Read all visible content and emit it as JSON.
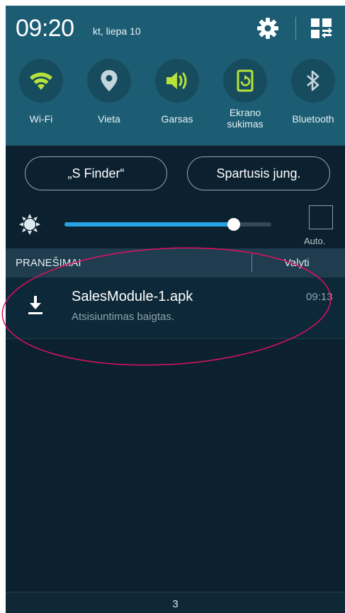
{
  "status": {
    "time": "09:20",
    "date": "kt, liepa 10"
  },
  "header_icons": {
    "settings": "gear-icon",
    "edit_grid": "grid-edit-icon"
  },
  "quick_toggles": [
    {
      "label": "Wi-Fi",
      "icon": "wifi-icon",
      "active": true
    },
    {
      "label": "Vieta",
      "icon": "location-pin-icon",
      "active": false
    },
    {
      "label": "Garsas",
      "icon": "speaker-icon",
      "active": true
    },
    {
      "label_line1": "Ekrano",
      "label_line2": "sukimas",
      "icon": "screen-rotation-icon",
      "active": true
    },
    {
      "label": "Bluetooth",
      "icon": "bluetooth-icon",
      "active": false
    }
  ],
  "buttons": {
    "s_finder": "„S Finder“",
    "quick_connect": "Spartusis jung."
  },
  "brightness": {
    "level": 0.82,
    "auto_label": "Auto.",
    "auto_checked": false
  },
  "notifications": {
    "title": "PRANEŠIMAI",
    "clear_label": "Valyti",
    "items": [
      {
        "icon": "download-icon",
        "title": "SalesModule-1.apk",
        "subtitle": "Atsisiuntimas baigtas.",
        "time": "09:13"
      }
    ]
  },
  "footer": {
    "count": "3"
  },
  "colors": {
    "header_bg": "#1c5d73",
    "panel_bg": "#0b2130",
    "active_icon": "#b6e23a",
    "inactive_icon": "#c4d5dc",
    "slider_fill": "#27a3e6",
    "annotation": "#e0115f"
  }
}
